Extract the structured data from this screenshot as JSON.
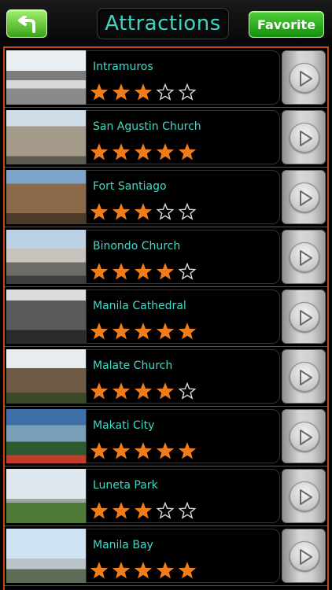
{
  "header": {
    "title": "Attractions",
    "favorite_label": "Favorite",
    "back_icon": "back-arrow-icon"
  },
  "colors": {
    "accent": "#3dd6c2",
    "star_filled": "#f07c1c",
    "list_border": "#c24a16",
    "button_green": "#3aa21a"
  },
  "attractions": [
    {
      "name": "Intramuros",
      "rating": 3,
      "max_rating": 5
    },
    {
      "name": "San Agustin Church",
      "rating": 5,
      "max_rating": 5
    },
    {
      "name": "Fort Santiago",
      "rating": 3,
      "max_rating": 5
    },
    {
      "name": "Binondo Church",
      "rating": 4,
      "max_rating": 5
    },
    {
      "name": "Manila Cathedral",
      "rating": 5,
      "max_rating": 5
    },
    {
      "name": "Malate Church",
      "rating": 4,
      "max_rating": 5
    },
    {
      "name": "Makati City",
      "rating": 5,
      "max_rating": 5
    },
    {
      "name": "Luneta Park",
      "rating": 3,
      "max_rating": 5
    },
    {
      "name": "Manila Bay",
      "rating": 5,
      "max_rating": 5
    }
  ]
}
